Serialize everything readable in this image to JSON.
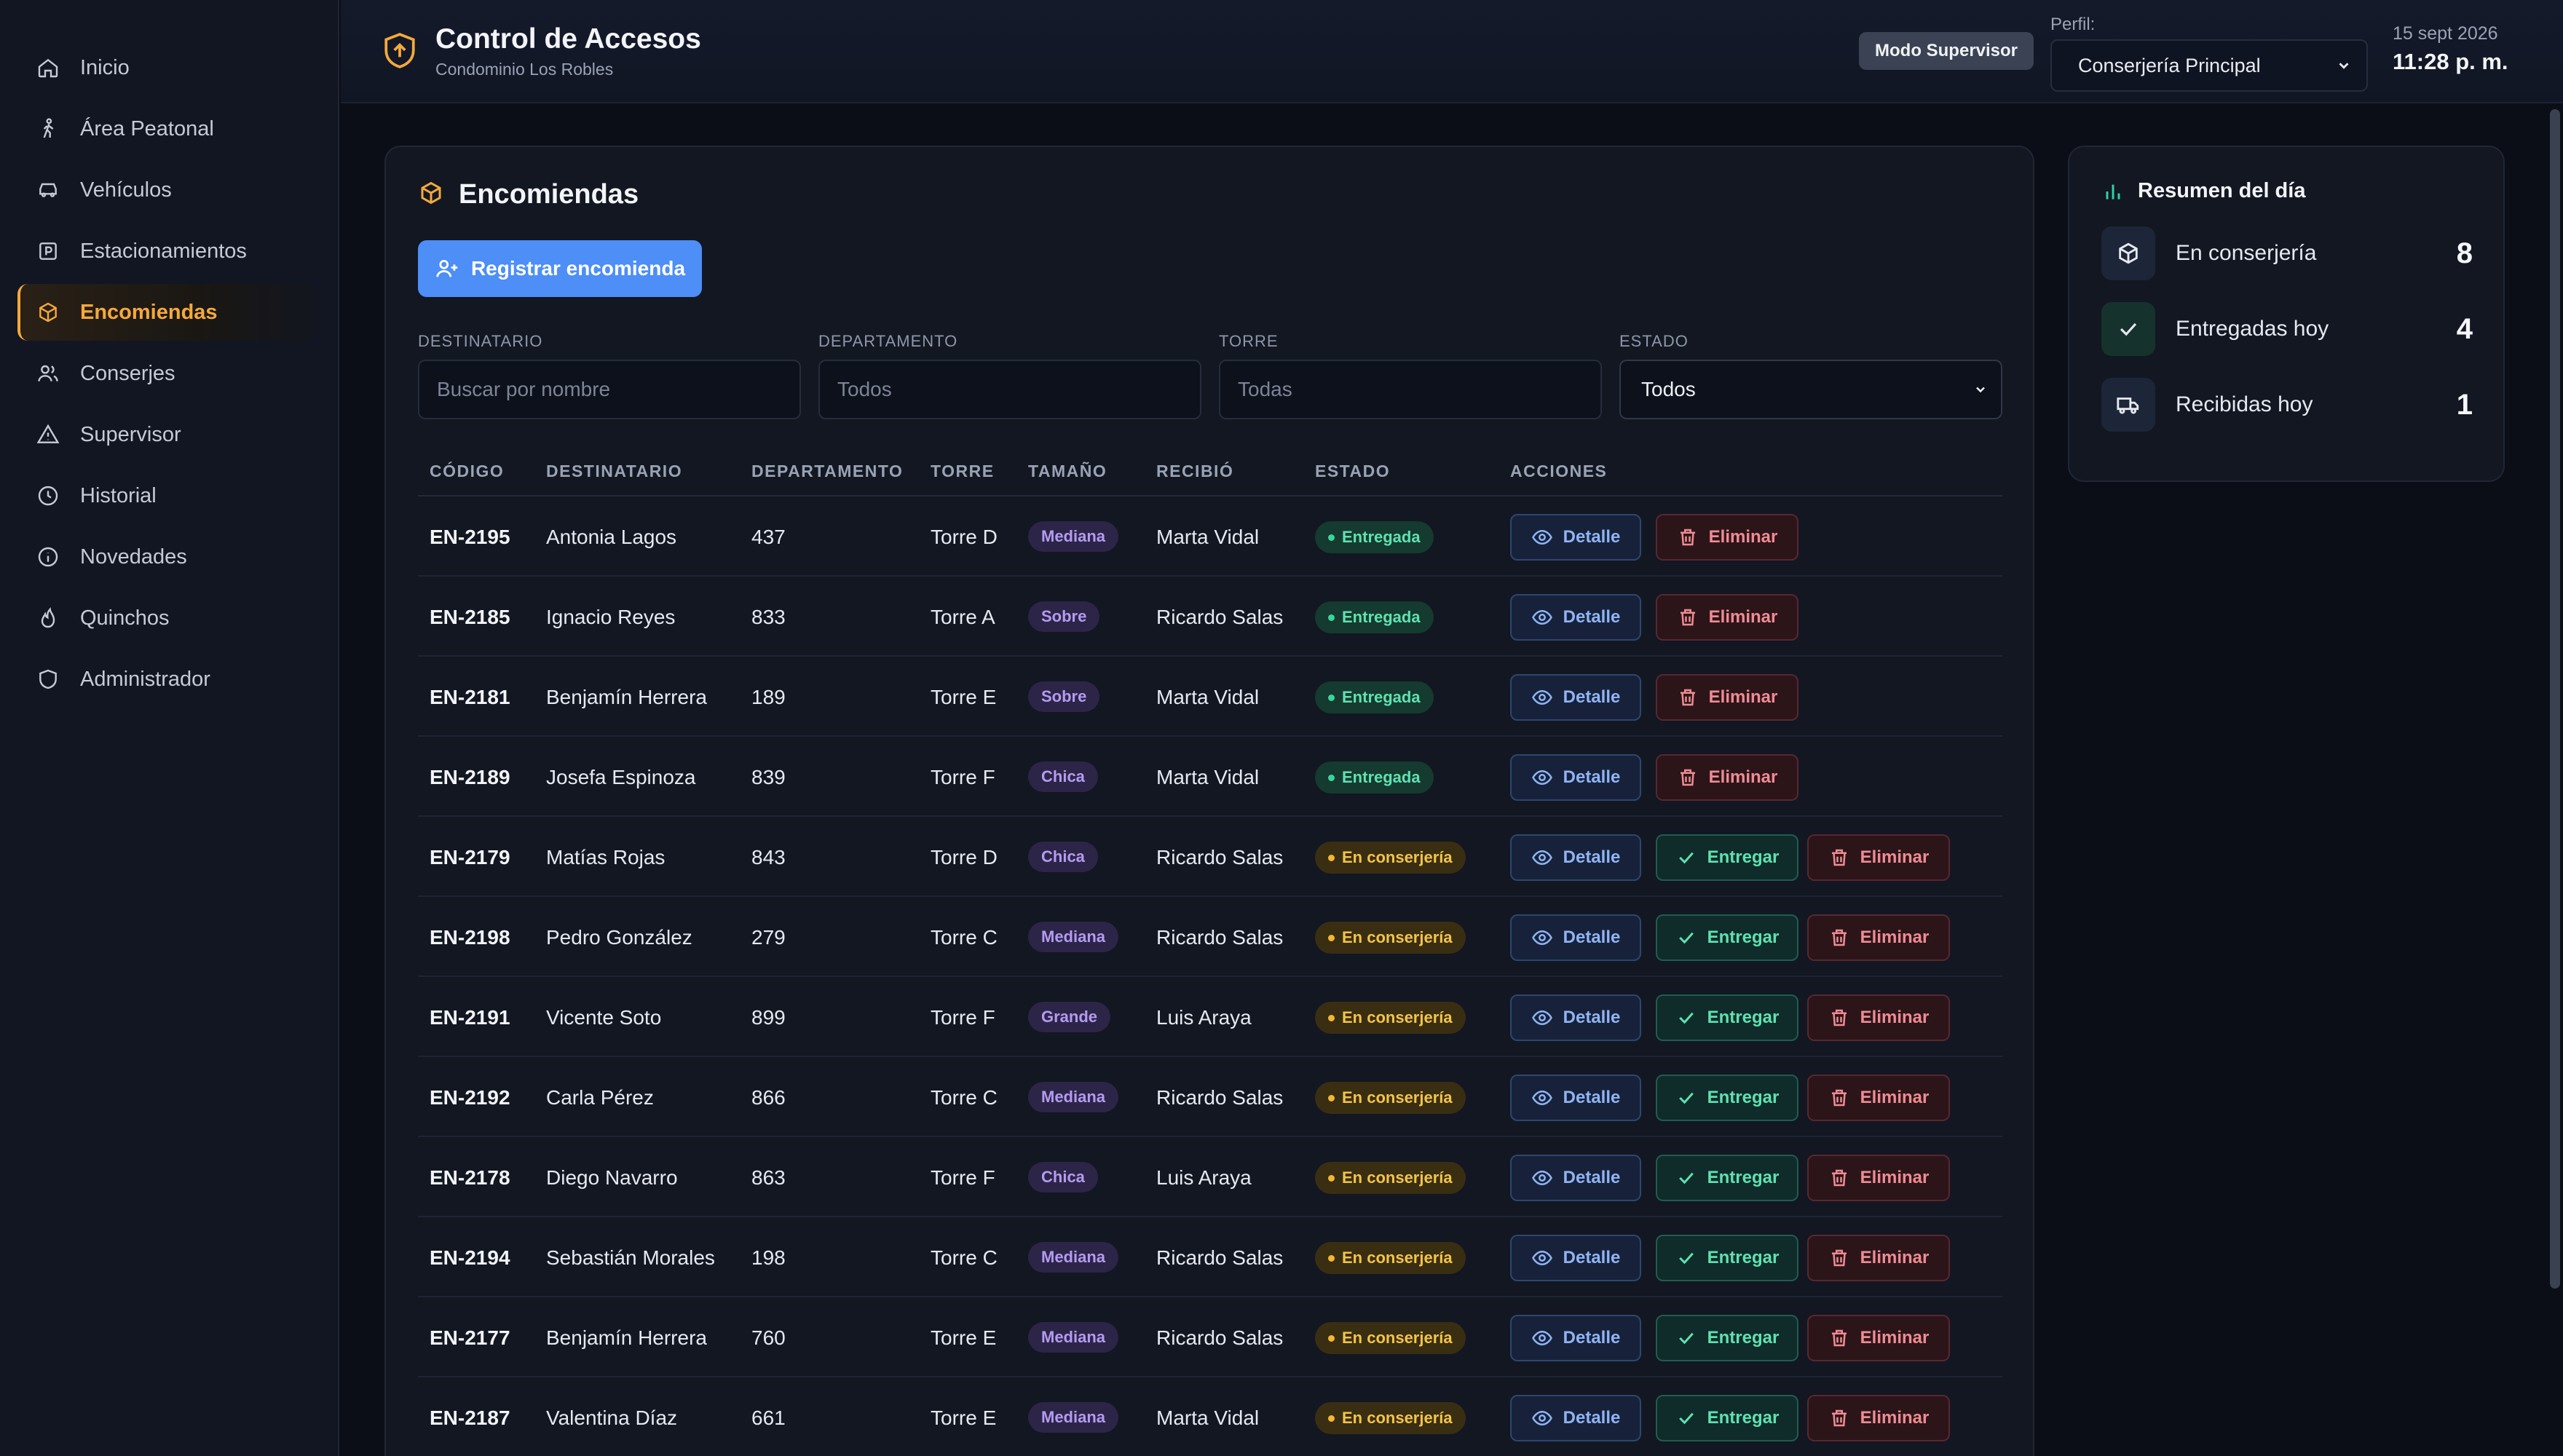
{
  "sidebar": {
    "items": [
      {
        "label": "Inicio",
        "icon": "home-icon"
      },
      {
        "label": "Área Peatonal",
        "icon": "walking-icon"
      },
      {
        "label": "Vehículos",
        "icon": "car-icon"
      },
      {
        "label": "Estacionamientos",
        "icon": "parking-icon"
      },
      {
        "label": "Encomiendas",
        "icon": "package-icon",
        "active": true
      },
      {
        "label": "Conserjes",
        "icon": "users-icon"
      },
      {
        "label": "Supervisor",
        "icon": "warning-icon"
      },
      {
        "label": "Historial",
        "icon": "clock-icon"
      },
      {
        "label": "Novedades",
        "icon": "info-icon"
      },
      {
        "label": "Quinchos",
        "icon": "flame-icon"
      },
      {
        "label": "Administrador",
        "icon": "shield-icon"
      }
    ]
  },
  "header": {
    "title": "Control de Accesos",
    "subtitle": "Condominio Los Robles",
    "mode_badge": "Modo Supervisor",
    "perfil_label": "Perfil:",
    "perfil_value": "Conserjería Principal",
    "date": "15 sept 2026",
    "time": "11:28 p. m."
  },
  "main": {
    "title": "Encomiendas",
    "register_button": "Registrar encomienda",
    "filters": {
      "destinatario_label": "DESTINATARIO",
      "destinatario_placeholder": "Buscar por nombre",
      "departamento_label": "DEPARTAMENTO",
      "departamento_placeholder": "Todos",
      "torre_label": "TORRE",
      "torre_placeholder": "Todas",
      "estado_label": "ESTADO",
      "estado_value": "Todos"
    },
    "columns": {
      "codigo": "CÓDIGO",
      "destinatario": "DESTINATARIO",
      "departamento": "DEPARTAMENTO",
      "torre": "TORRE",
      "tamano": "TAMAÑO",
      "recibio": "RECIBIÓ",
      "estado": "ESTADO",
      "acciones": "ACCIONES"
    },
    "actions": {
      "detail": "Detalle",
      "deliver": "Entregar",
      "delete": "Eliminar"
    },
    "rows": [
      {
        "code": "EN-2195",
        "name": "Antonia Lagos",
        "dept": "437",
        "tower": "Torre D",
        "size": "Mediana",
        "received_by": "Marta Vidal",
        "status": "Entregada"
      },
      {
        "code": "EN-2185",
        "name": "Ignacio Reyes",
        "dept": "833",
        "tower": "Torre A",
        "size": "Sobre",
        "received_by": "Ricardo Salas",
        "status": "Entregada"
      },
      {
        "code": "EN-2181",
        "name": "Benjamín Herrera",
        "dept": "189",
        "tower": "Torre E",
        "size": "Sobre",
        "received_by": "Marta Vidal",
        "status": "Entregada"
      },
      {
        "code": "EN-2189",
        "name": "Josefa Espinoza",
        "dept": "839",
        "tower": "Torre F",
        "size": "Chica",
        "received_by": "Marta Vidal",
        "status": "Entregada"
      },
      {
        "code": "EN-2179",
        "name": "Matías Rojas",
        "dept": "843",
        "tower": "Torre D",
        "size": "Chica",
        "received_by": "Ricardo Salas",
        "status": "En conserjería"
      },
      {
        "code": "EN-2198",
        "name": "Pedro González",
        "dept": "279",
        "tower": "Torre C",
        "size": "Mediana",
        "received_by": "Ricardo Salas",
        "status": "En conserjería"
      },
      {
        "code": "EN-2191",
        "name": "Vicente Soto",
        "dept": "899",
        "tower": "Torre F",
        "size": "Grande",
        "received_by": "Luis Araya",
        "status": "En conserjería"
      },
      {
        "code": "EN-2192",
        "name": "Carla Pérez",
        "dept": "866",
        "tower": "Torre C",
        "size": "Mediana",
        "received_by": "Ricardo Salas",
        "status": "En conserjería"
      },
      {
        "code": "EN-2178",
        "name": "Diego Navarro",
        "dept": "863",
        "tower": "Torre F",
        "size": "Chica",
        "received_by": "Luis Araya",
        "status": "En conserjería"
      },
      {
        "code": "EN-2194",
        "name": "Sebastián Morales",
        "dept": "198",
        "tower": "Torre C",
        "size": "Mediana",
        "received_by": "Ricardo Salas",
        "status": "En conserjería"
      },
      {
        "code": "EN-2177",
        "name": "Benjamín Herrera",
        "dept": "760",
        "tower": "Torre E",
        "size": "Mediana",
        "received_by": "Ricardo Salas",
        "status": "En conserjería"
      },
      {
        "code": "EN-2187",
        "name": "Valentina Díaz",
        "dept": "661",
        "tower": "Torre E",
        "size": "Mediana",
        "received_by": "Marta Vidal",
        "status": "En conserjería"
      }
    ]
  },
  "summary": {
    "title": "Resumen del día",
    "items": [
      {
        "label": "En conserjería",
        "value": "8",
        "icon": "package-icon"
      },
      {
        "label": "Entregadas hoy",
        "value": "4",
        "icon": "check-icon"
      },
      {
        "label": "Recibidas hoy",
        "value": "1",
        "icon": "truck-icon"
      }
    ]
  },
  "colors": {
    "accent": "#f5a93b",
    "primary_button": "#4d8ef7",
    "delivered": "#37d69a",
    "pending": "#f3b731",
    "danger": "#f08b93"
  }
}
